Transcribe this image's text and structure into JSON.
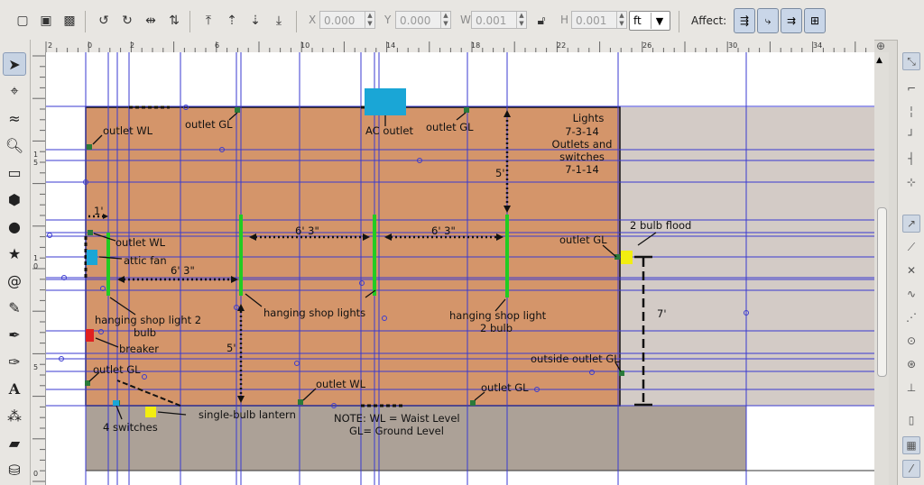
{
  "toolbar": {
    "x_label": "X",
    "x_value": "0.000",
    "y_label": "Y",
    "y_value": "0.000",
    "w_label": "W",
    "w_value": "0.001",
    "h_label": "H",
    "h_value": "0.001",
    "unit": "ft",
    "affect_label": "Affect:"
  },
  "ruler": {
    "h_ticks": [
      "2",
      "0",
      "2",
      "6",
      "10",
      "14",
      "18",
      "22",
      "26",
      "30",
      "34"
    ],
    "v_ticks": [
      "1\n5",
      "1\n0",
      "5",
      "0"
    ]
  },
  "labels": {
    "outlet_wl_top": "outlet WL",
    "outlet_gl_top_left": "outlet GL",
    "ac_outlet": "AC outlet",
    "outlet_gl_top_right": "outlet GL",
    "dates": [
      "Lights",
      "7-3-14",
      "Outlets and",
      "switches",
      "7-1-14"
    ],
    "five_ft_top": "5'",
    "one_ft": "1'",
    "six_three_1": "6' 3\"",
    "six_three_2": "6' 3\"",
    "six_three_3": "6' 3\"",
    "outlet_wl_left": "outlet WL",
    "attic_fan": "attic fan",
    "outlet_gl_right": "outlet GL",
    "two_bulb_flood": "2 bulb flood",
    "seven_ft": "7'",
    "hanging_light_2bulb_a": "hanging shop light 2",
    "hanging_light_2bulb_b": "bulb",
    "hanging_shop_lights": "hanging shop lights",
    "hanging_light_right_a": "hanging shop light",
    "hanging_light_right_b": "2 bulb",
    "breaker": "breaker",
    "five_ft_bottom": "5'",
    "outlet_gl_left_bottom": "outlet GL",
    "outside_outlet_gl": "outside outlet GL",
    "outlet_wl_bottom": "outlet WL",
    "outlet_gl_bottom": "outlet GL",
    "four_switches": "4 switches",
    "single_bulb_lantern": "single-bulb lantern",
    "note_1": "NOTE: WL = Waist Level",
    "note_2": "GL= Ground Level"
  },
  "colors": {
    "room_fill": "#d4956a",
    "ground_fill": "#aca197",
    "right_area": "#d3cbc6",
    "guide": "#3a3ad0",
    "light_green": "#22cc22",
    "outlet_green": "#2a7a3a",
    "ac_blue": "#1aa6d6",
    "breaker_red": "#e02020",
    "lantern_yellow": "#f2ee10"
  },
  "icons": {
    "toolbox": [
      "selector-icon",
      "node-icon",
      "tweak-icon",
      "zoom-icon",
      "rect-icon",
      "box3d-icon",
      "ellipse-icon",
      "star-icon",
      "spiral-icon",
      "pencil-icon",
      "pen-icon",
      "calligraphy-icon",
      "text-icon",
      "spray-icon",
      "eraser-icon",
      "paint-bucket-icon"
    ]
  }
}
